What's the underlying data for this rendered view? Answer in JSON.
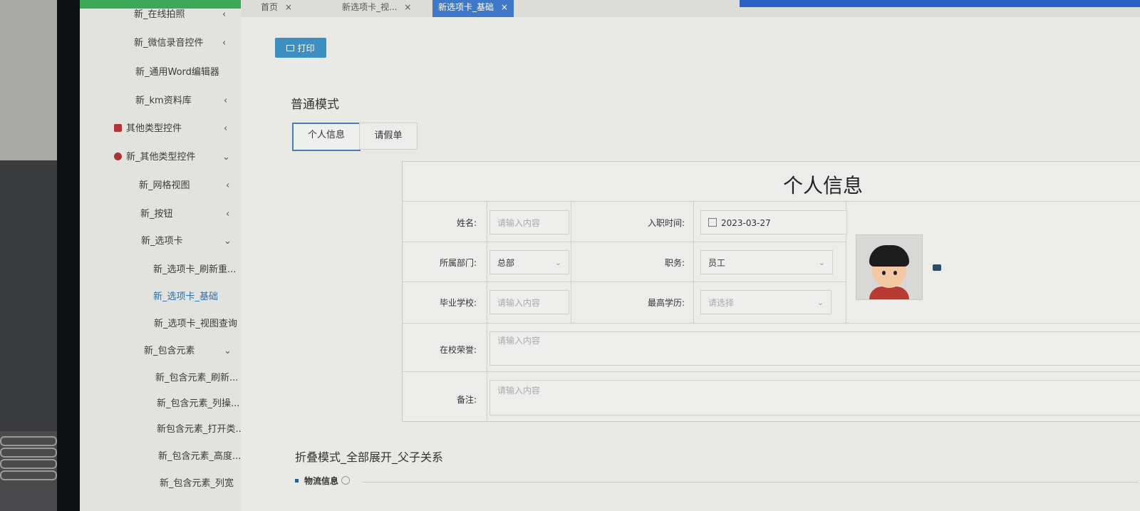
{
  "sidebar": {
    "items": [
      {
        "label": "新_在线拍照",
        "chevron": "‹"
      },
      {
        "label": "新_微信录音控件",
        "chevron": "‹"
      },
      {
        "label": "新_通用Word编辑器",
        "chevron": ""
      },
      {
        "label": "新_km资料库",
        "chevron": "‹"
      },
      {
        "label": "其他类型控件",
        "chevron": "‹",
        "icon": "cube-icon"
      },
      {
        "label": "新_其他类型控件",
        "chevron": "⌄",
        "icon": "cubes-icon"
      },
      {
        "label": "新_网格视图",
        "chevron": "‹"
      },
      {
        "label": "新_按钮",
        "chevron": "‹"
      },
      {
        "label": "新_选项卡",
        "chevron": "⌄"
      },
      {
        "label": "新_选项卡_刷新重...",
        "chevron": ""
      },
      {
        "label": "新_选项卡_基础",
        "chevron": "",
        "active": true
      },
      {
        "label": "新_选项卡_视图查询",
        "chevron": ""
      },
      {
        "label": "新_包含元素",
        "chevron": "⌄"
      },
      {
        "label": "新_包含元素_刷新...",
        "chevron": ""
      },
      {
        "label": "新_包含元素_列操...",
        "chevron": ""
      },
      {
        "label": "新包含元素_打开类...",
        "chevron": ""
      },
      {
        "label": "新_包含元素_高度...",
        "chevron": ""
      },
      {
        "label": "新_包含元素_列宽",
        "chevron": ""
      }
    ]
  },
  "tabbar": {
    "tabs": [
      {
        "label": "首页",
        "close": "×"
      },
      {
        "label": "新选项卡_视...",
        "close": "×"
      },
      {
        "label": "新选项卡_基础",
        "close": "×",
        "active": true
      }
    ]
  },
  "toolbar": {
    "print_label": "打印"
  },
  "sections": {
    "normal_title": "普通模式",
    "collapse_title": "折叠模式_全部展开_父子关系"
  },
  "form_tabs": [
    {
      "label": "个人信息",
      "active": true
    },
    {
      "label": "请假单",
      "active": false
    }
  ],
  "form": {
    "title": "个人信息",
    "name_label": "姓名:",
    "name_placeholder": "请输入内容",
    "hire_date_label": "入职时间:",
    "hire_date_value": "2023-03-27",
    "dept_label": "所属部门:",
    "dept_value": "总部",
    "position_label": "职务:",
    "position_value": "员工",
    "school_label": "毕业学校:",
    "school_placeholder": "请输入内容",
    "education_label": "最高学历:",
    "education_placeholder": "请选择",
    "honors_label": "在校荣誉:",
    "honors_placeholder": "请输入内容",
    "remarks_label": "备注:",
    "remarks_placeholder": "请输入内容"
  },
  "collapse": {
    "panel_label": "物流信息"
  },
  "colors": {
    "accent": "#3f78c6",
    "print_button": "#3d8fc2",
    "sidebar_top": "#3aa857",
    "active_tab_border": "#4a7fb4"
  }
}
